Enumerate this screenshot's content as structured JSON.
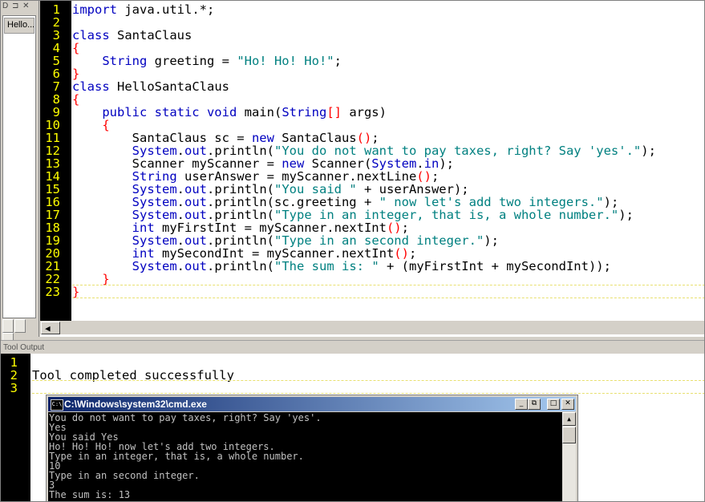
{
  "doc_panel": {
    "header": "D ⊐ ✕",
    "open_document": "Hello..."
  },
  "editor": {
    "line_numbers": [
      "1",
      "2",
      "3",
      "4",
      "5",
      "6",
      "7",
      "8",
      "9",
      "10",
      "11",
      "12",
      "13",
      "14",
      "15",
      "16",
      "17",
      "18",
      "19",
      "20",
      "21",
      "22",
      "23"
    ],
    "code_lines": [
      [
        [
          "kw",
          "import"
        ],
        [
          "t",
          " java.util.*;"
        ]
      ],
      [],
      [
        [
          "kw",
          "class"
        ],
        [
          "t",
          " SantaClaus"
        ]
      ],
      [
        [
          "br",
          "{"
        ]
      ],
      [
        [
          "t",
          "    "
        ],
        [
          "kw",
          "String"
        ],
        [
          "t",
          " greeting = "
        ],
        [
          "str",
          "\"Ho! Ho! Ho!\""
        ],
        [
          "t",
          ";"
        ]
      ],
      [
        [
          "br",
          "}"
        ]
      ],
      [
        [
          "kw",
          "class"
        ],
        [
          "t",
          " HelloSantaClaus"
        ]
      ],
      [
        [
          "br",
          "{"
        ]
      ],
      [
        [
          "t",
          "    "
        ],
        [
          "kw",
          "public static void"
        ],
        [
          "t",
          " main("
        ],
        [
          "kw",
          "String"
        ],
        [
          "br",
          "[]"
        ],
        [
          "t",
          " args)"
        ]
      ],
      [
        [
          "t",
          "    "
        ],
        [
          "br",
          "{"
        ]
      ],
      [
        [
          "t",
          "        SantaClaus sc = "
        ],
        [
          "kw",
          "new"
        ],
        [
          "t",
          " SantaClaus"
        ],
        [
          "br",
          "()"
        ],
        [
          "t",
          ";"
        ]
      ],
      [
        [
          "t",
          "        "
        ],
        [
          "kw",
          "System"
        ],
        [
          "t",
          "."
        ],
        [
          "kw",
          "out"
        ],
        [
          "t",
          ".println("
        ],
        [
          "str",
          "\"You do not want to pay taxes, right? Say 'yes'.\""
        ],
        [
          "t",
          ");"
        ]
      ],
      [
        [
          "t",
          "        Scanner myScanner = "
        ],
        [
          "kw",
          "new"
        ],
        [
          "t",
          " Scanner("
        ],
        [
          "kw",
          "System"
        ],
        [
          "t",
          "."
        ],
        [
          "kw",
          "in"
        ],
        [
          "t",
          ");"
        ]
      ],
      [
        [
          "t",
          "        "
        ],
        [
          "kw",
          "String"
        ],
        [
          "t",
          " userAnswer = myScanner.nextLine"
        ],
        [
          "br",
          "()"
        ],
        [
          "t",
          ";"
        ]
      ],
      [
        [
          "t",
          "        "
        ],
        [
          "kw",
          "System"
        ],
        [
          "t",
          "."
        ],
        [
          "kw",
          "out"
        ],
        [
          "t",
          ".println("
        ],
        [
          "str",
          "\"You said \""
        ],
        [
          "t",
          " + userAnswer);"
        ]
      ],
      [
        [
          "t",
          "        "
        ],
        [
          "kw",
          "System"
        ],
        [
          "t",
          "."
        ],
        [
          "kw",
          "out"
        ],
        [
          "t",
          ".println(sc.greeting + "
        ],
        [
          "str",
          "\" now let's add two integers.\""
        ],
        [
          "t",
          ");"
        ]
      ],
      [
        [
          "t",
          "        "
        ],
        [
          "kw",
          "System"
        ],
        [
          "t",
          "."
        ],
        [
          "kw",
          "out"
        ],
        [
          "t",
          ".println("
        ],
        [
          "str",
          "\"Type in an integer, that is, a whole number.\""
        ],
        [
          "t",
          ");"
        ]
      ],
      [
        [
          "t",
          "        "
        ],
        [
          "kw",
          "int"
        ],
        [
          "t",
          " myFirstInt = myScanner.nextInt"
        ],
        [
          "br",
          "()"
        ],
        [
          "t",
          ";"
        ]
      ],
      [
        [
          "t",
          "        "
        ],
        [
          "kw",
          "System"
        ],
        [
          "t",
          "."
        ],
        [
          "kw",
          "out"
        ],
        [
          "t",
          ".println("
        ],
        [
          "str",
          "\"Type in an second integer.\""
        ],
        [
          "t",
          ");"
        ]
      ],
      [
        [
          "t",
          "        "
        ],
        [
          "kw",
          "int"
        ],
        [
          "t",
          " mySecondInt = myScanner.nextInt"
        ],
        [
          "br",
          "()"
        ],
        [
          "t",
          ";"
        ]
      ],
      [
        [
          "t",
          "        "
        ],
        [
          "kw",
          "System"
        ],
        [
          "t",
          "."
        ],
        [
          "kw",
          "out"
        ],
        [
          "t",
          ".println("
        ],
        [
          "str",
          "\"The sum is: \""
        ],
        [
          "t",
          " + (myFirstInt + mySecondInt));"
        ]
      ],
      [
        [
          "t",
          "    "
        ],
        [
          "br",
          "}"
        ]
      ],
      [
        [
          "br",
          "}"
        ]
      ]
    ],
    "scroll_arrow": "◀"
  },
  "tool_output": {
    "header": "Tool Output",
    "line_numbers": [
      "1",
      "2",
      "3"
    ],
    "message": "Tool completed successfully"
  },
  "cmd_window": {
    "icon_text": "C:\\",
    "title": "C:\\Windows\\system32\\cmd.exe",
    "minimize": "_",
    "restore": "⧉",
    "maximize": "□",
    "close": "✕",
    "lines": [
      "You do not want to pay taxes, right? Say 'yes'.",
      "Yes",
      "You said Yes",
      "Ho! Ho! Ho! now let's add two integers.",
      "Type in an integer, that is, a whole number.",
      "10",
      "Type in an second integer.",
      "3",
      "The sum is: 13"
    ],
    "scroll_up": "▲"
  },
  "colors": {
    "keyword": "#0000c0",
    "string": "#008080",
    "bracket": "#ff0000",
    "line_number": "#ffff00",
    "gutter": "#000000"
  }
}
